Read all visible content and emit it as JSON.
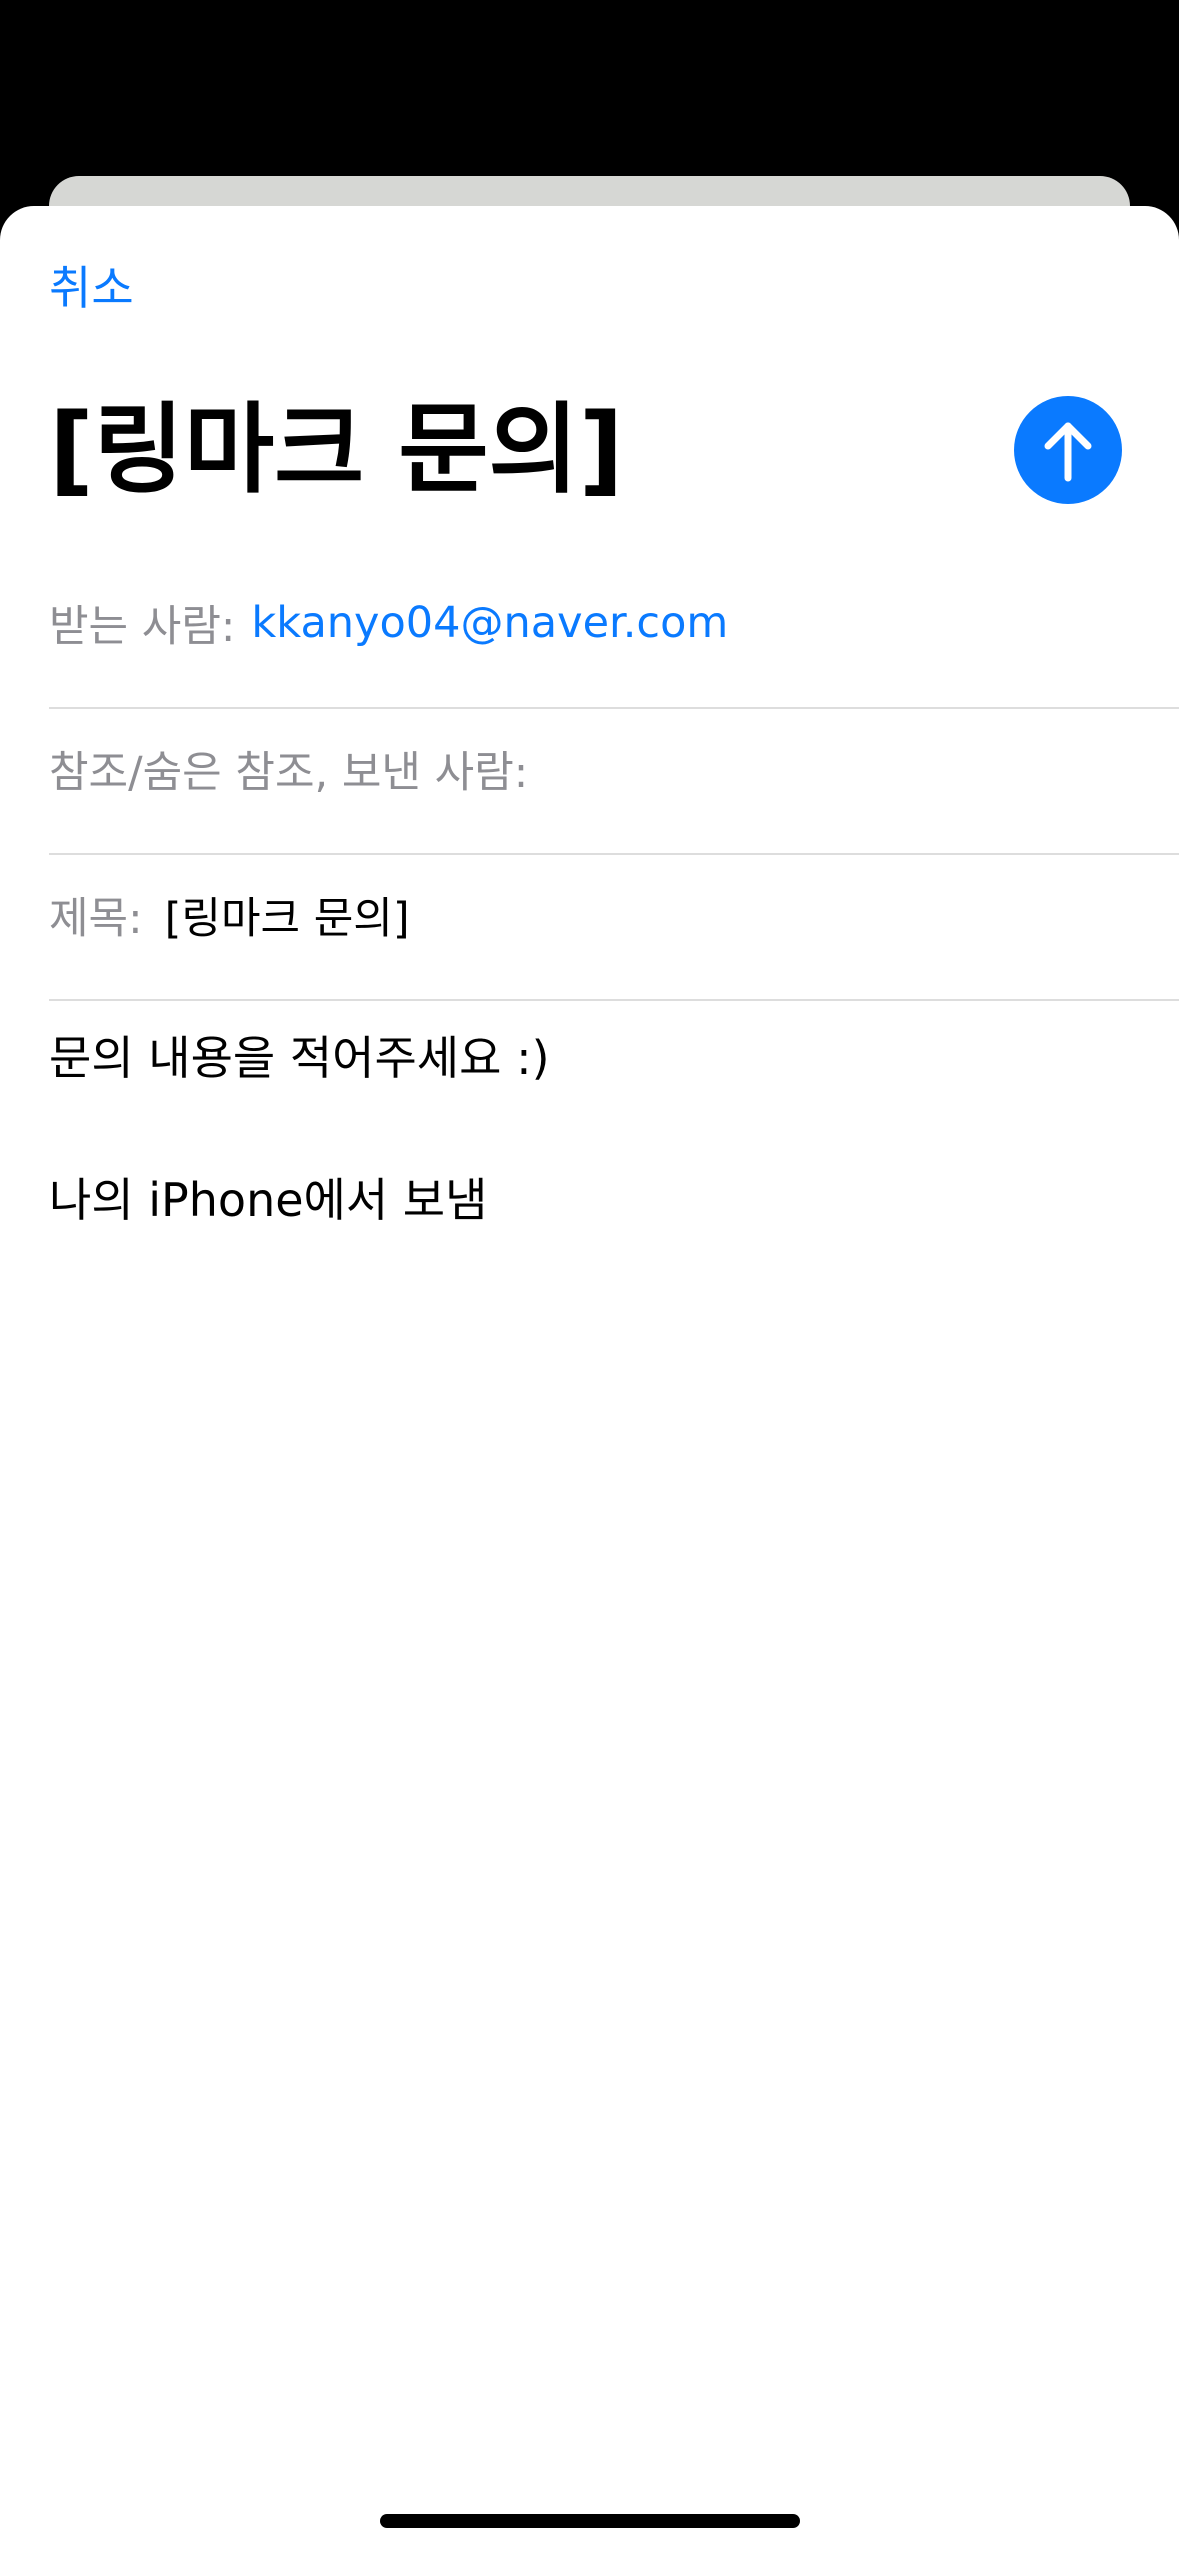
{
  "compose": {
    "cancel_label": "취소",
    "title": "[링마크 문의]",
    "send_icon": "arrow-up-icon",
    "to": {
      "label": "받는 사람:",
      "recipient": "kkanyo04@naver.com"
    },
    "cc_bcc": {
      "label": "참조/숨은 참조, 보낸 사람:",
      "value": ""
    },
    "subject": {
      "label": "제목:",
      "value": "[링마크 문의]"
    },
    "body": {
      "message": "문의 내용을 적어주세요 :)",
      "signature": "나의 iPhone에서 보냄"
    },
    "accent_color": "#0a7aff"
  }
}
